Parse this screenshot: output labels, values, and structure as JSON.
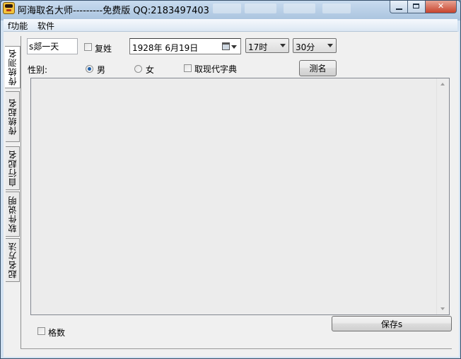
{
  "window": {
    "title": "阿海取名大师---------免费版 QQ:2183497403"
  },
  "menu": {
    "items": [
      {
        "label": "f功能"
      },
      {
        "label": "软件"
      }
    ]
  },
  "tabs": [
    {
      "label": "传统测名",
      "active": true
    },
    {
      "label": "传统起名",
      "active": false
    },
    {
      "label": "自行起名",
      "active": false
    },
    {
      "label": "软件说明",
      "active": false
    },
    {
      "label": "起名方法",
      "active": false
    }
  ],
  "form": {
    "name_value": "s郯一天",
    "compound_surname_label": "复姓",
    "compound_surname_checked": false,
    "birth_date": "1928年  6月19日",
    "hour_value": "17时",
    "minute_value": "30分",
    "gender_label": "性别:",
    "gender_male": "男",
    "gender_female": "女",
    "gender_selected": "男",
    "modern_dict_label": "取现代字典",
    "modern_dict_checked": false,
    "test_button": "测名",
    "result_text": "",
    "stroke_count_label": "格数",
    "stroke_count_checked": false,
    "save_button": "保存s"
  },
  "colors": {
    "titlebar": "#a9c3de",
    "client_bg": "#f0f0f0",
    "radio_dot": "#1f5fa8"
  }
}
